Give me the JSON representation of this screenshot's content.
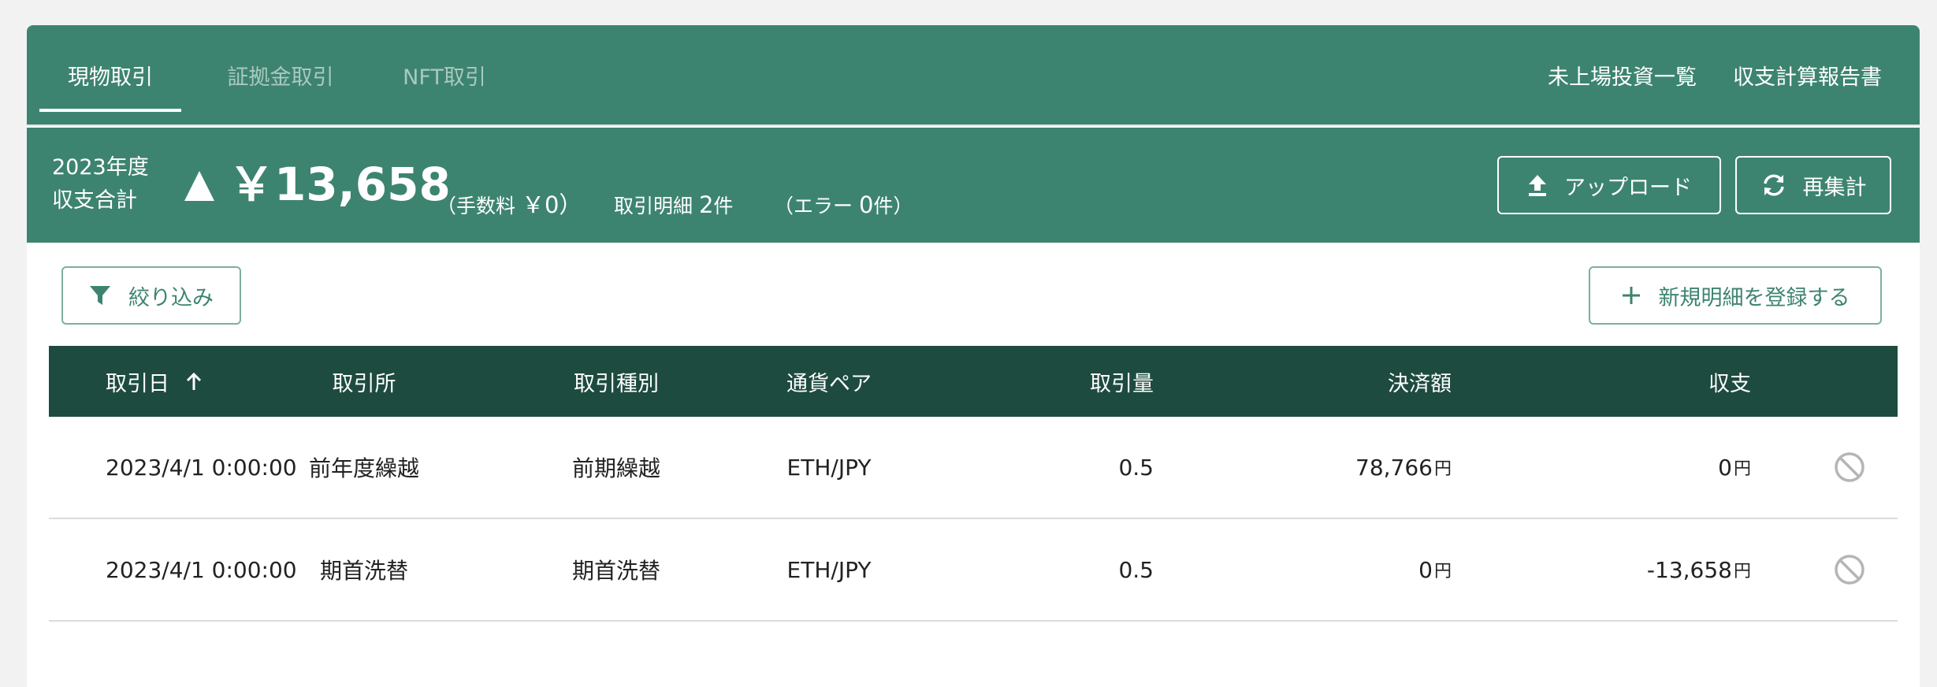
{
  "tabs": [
    {
      "label": "現物取引",
      "active": true
    },
    {
      "label": "証拠金取引",
      "active": false
    },
    {
      "label": "NFT取引",
      "active": false
    }
  ],
  "top_links": [
    "未上場投資一覧",
    "収支計算報告書"
  ],
  "summary": {
    "fiscal_year": "2023年度",
    "total_label": "収支合計",
    "total_value": "￥13,658",
    "fee_label": "（手数料",
    "fee_value": "￥0）",
    "count_label": "取引明細",
    "count_value": "2",
    "count_unit": "件",
    "error_label": "（エラー",
    "error_value": "0",
    "error_unit": "件）"
  },
  "buttons": {
    "upload": "アップロード",
    "recalc": "再集計",
    "filter": "絞り込み",
    "new_entry": "新規明細を登録する"
  },
  "table": {
    "columns": [
      "取引日",
      "取引所",
      "取引種別",
      "通貨ペア",
      "取引量",
      "決済額",
      "収支"
    ],
    "currency_unit": "円",
    "rows": [
      {
        "date": "2023/4/1 0:00:00",
        "exchange": "前年度繰越",
        "type": "前期繰越",
        "pair": "ETH/JPY",
        "amount": "0.5",
        "settlement": "78,766",
        "pnl": "0"
      },
      {
        "date": "2023/4/1 0:00:00",
        "exchange": "期首洗替",
        "type": "期首洗替",
        "pair": "ETH/JPY",
        "amount": "0.5",
        "settlement": "0",
        "pnl": "-13,658"
      }
    ]
  },
  "colors": {
    "header_green": "#3d8470",
    "table_header": "#1e4b3f",
    "outline": "#7eaea0"
  },
  "icons": [
    "upload-icon",
    "refresh-icon",
    "filter-icon",
    "plus-icon",
    "sort-up-icon",
    "disable-icon"
  ]
}
